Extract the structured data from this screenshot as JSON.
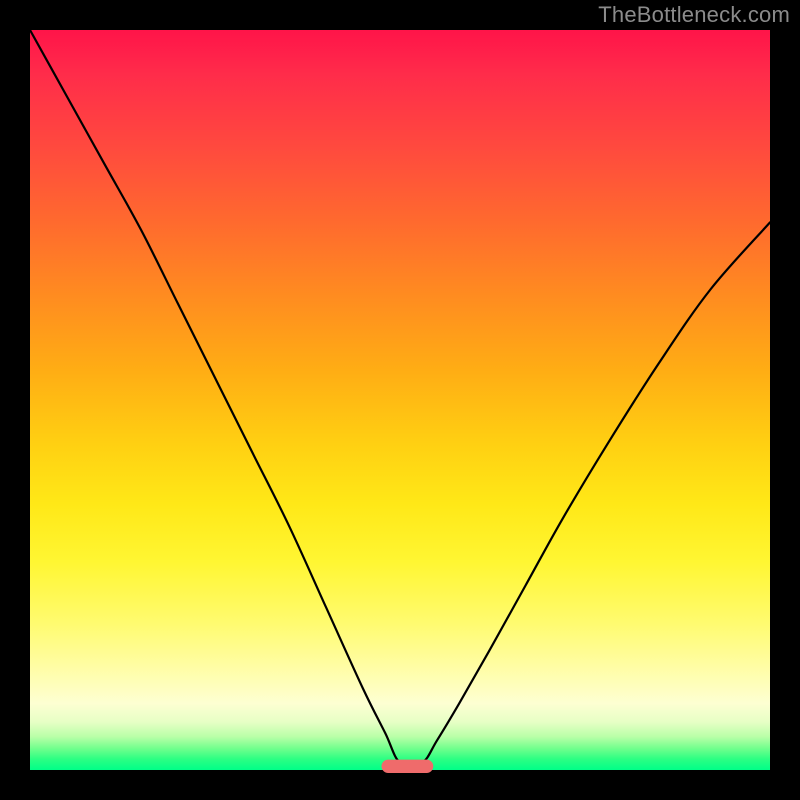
{
  "watermark": "TheBottleneck.com",
  "chart_data": {
    "type": "line",
    "title": "",
    "xlabel": "",
    "ylabel": "",
    "xlim": [
      0,
      100
    ],
    "ylim": [
      0,
      100
    ],
    "grid": false,
    "legend": false,
    "note": "No axis ticks or labels are visible; values are estimated from pixel positions as percentages of the plot area (0-100). y=0 is the bottom (green) edge, y=100 is the top (red) edge.",
    "series": [
      {
        "name": "curve",
        "x": [
          0,
          5,
          10,
          15,
          20,
          25,
          30,
          35,
          40,
          45,
          48,
          50,
          53,
          55,
          58,
          62,
          67,
          72,
          78,
          85,
          92,
          100
        ],
        "y": [
          100,
          91,
          82,
          73,
          63,
          53,
          43,
          33,
          22,
          11,
          5,
          1,
          1,
          4,
          9,
          16,
          25,
          34,
          44,
          55,
          65,
          74
        ]
      }
    ],
    "marker": {
      "name": "bottom-pill",
      "x_center": 51,
      "y_center": 0.5,
      "width": 7,
      "height": 1.8,
      "color": "#ef6b6b"
    },
    "background_gradient": {
      "direction": "top-to-bottom",
      "stops": [
        {
          "pos": 0.0,
          "color": "#ff1449"
        },
        {
          "pos": 0.26,
          "color": "#ff6a2e"
        },
        {
          "pos": 0.56,
          "color": "#ffd012"
        },
        {
          "pos": 0.8,
          "color": "#fffb6e"
        },
        {
          "pos": 0.95,
          "color": "#b9ffa8"
        },
        {
          "pos": 1.0,
          "color": "#00ff88"
        }
      ]
    }
  }
}
